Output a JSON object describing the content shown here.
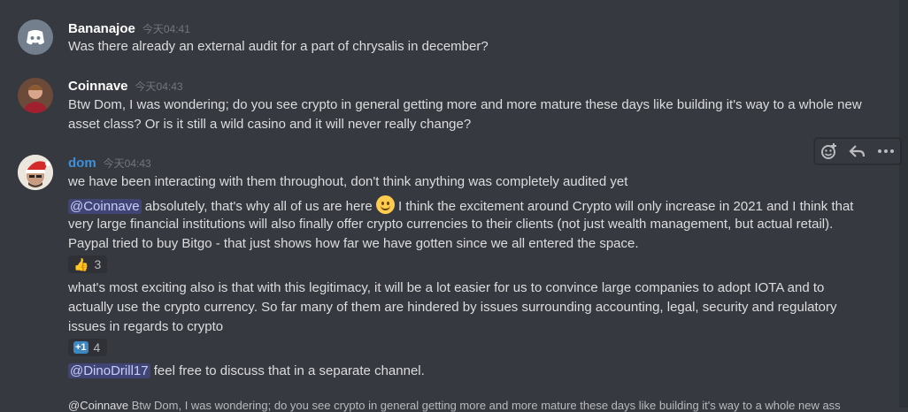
{
  "messages": [
    {
      "username": "Bananajoe",
      "timestamp": "今天04:41",
      "lines": [
        "Was there already an external audit for a part of chrysalis in december?"
      ]
    },
    {
      "username": "Coinnave",
      "timestamp": "今天04:43",
      "lines": [
        "Btw Dom, I was wondering; do you see crypto in general getting more and more mature these days like building it's way to a whole new",
        "asset class? Or is it still a wild casino and it will never really change?"
      ]
    },
    {
      "username": "dom",
      "timestamp": "今天04:43",
      "line1": "we have been interacting with them throughout, don't think anything was completely audited yet",
      "line2_mention": "@Coinnave",
      "line2_a": " absolutely, that's why all of us are here ",
      "line2_b": " I think the excitement around Crypto will only increase in 2021 and I think that",
      "line3": "very large financial institutions will also finally offer crypto currencies to their clients (not just wealth management, but actual retail).",
      "line4": "Paypal tried to buy Bitgo - that just shows how far we have gotten since we all entered the space.",
      "reaction1": {
        "icon": "thumbs-up-icon",
        "glyph": "👍",
        "count": "3"
      },
      "line5": "what's most exciting also is that with this legitimacy, it will be a lot easier for us to convince large companies to adopt IOTA and to",
      "line6": "actually use the crypto currency. So far many of them are hindered by issues surrounding accounting, legal, security and regulatory",
      "line7": "issues in regards to crypto",
      "reaction2": {
        "icon": "plus-one-icon",
        "glyph": "+1",
        "count": "4"
      },
      "line8_mention": "@DinoDrill17",
      "line8_text": " feel free to discuss that in a separate channel."
    }
  ],
  "reply_preview": {
    "mention": "@Coinnave",
    "text": " Btw Dom, I was wondering; do you see crypto in general getting more and more mature these days like building it's way to a whole new ass"
  },
  "colors": {
    "background": "#36393f",
    "mention": "#c9cdfb",
    "dom_name": "#3f8fd9"
  }
}
